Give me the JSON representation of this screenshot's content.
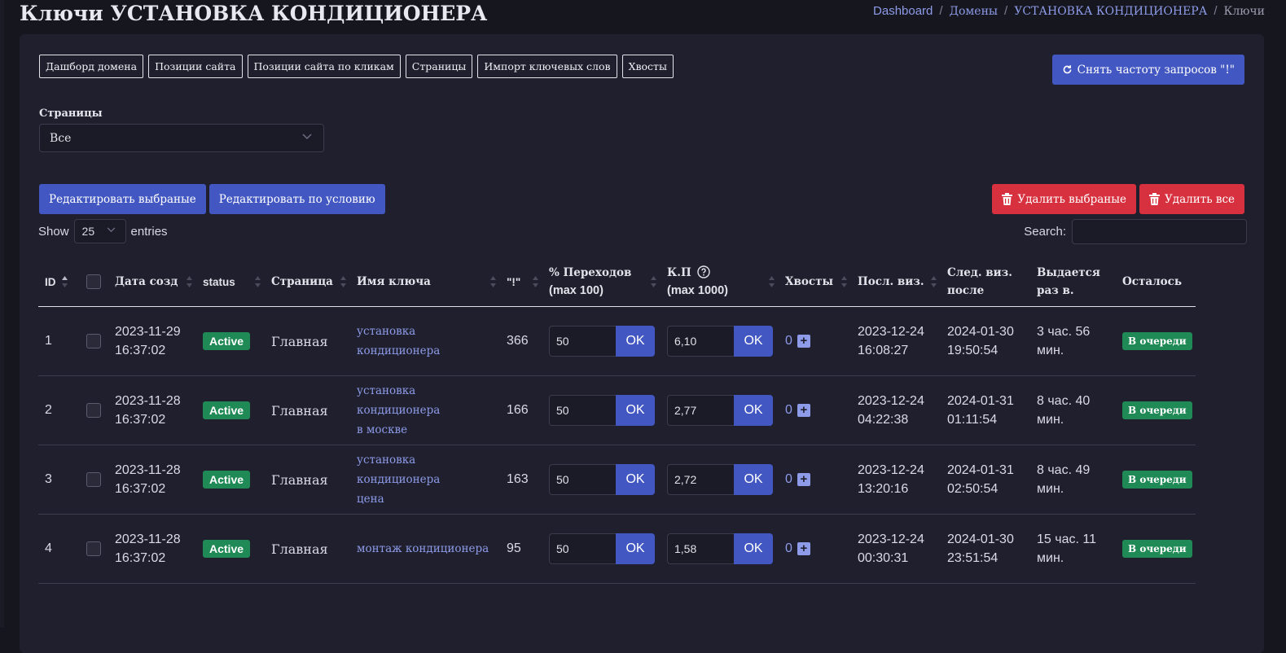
{
  "page": {
    "title": "Ключи УСТАНОВКА КОНДИЦИОНЕРА"
  },
  "breadcrumb": {
    "items": [
      "Dashboard",
      "Домены",
      "УСТАНОВКА КОНДИЦИОНЕРА"
    ],
    "current": "Ключи",
    "separator": "/"
  },
  "tabs": [
    "Дашборд домена",
    "Позиции сайта",
    "Позиции сайта по кликам",
    "Страницы",
    "Импорт ключевых слов",
    "Хвосты"
  ],
  "refresh_button": {
    "label": "Снять частоту запросов \"!\"",
    "icon": "refresh-icon"
  },
  "pages_filter": {
    "label": "Страницы",
    "value": "Все"
  },
  "actions": {
    "edit_selected": "Редактировать выбраные",
    "edit_by_condition": "Редактировать по условию",
    "delete_selected": "Удалить выбраные",
    "delete_all": "Удалить все"
  },
  "datatable": {
    "show_label": "Show",
    "length": "25",
    "entries_label": "entries",
    "search_label": "Search:",
    "search_value": ""
  },
  "columns": {
    "id": "ID",
    "date": "Дата созд",
    "status": "status",
    "page": "Страница",
    "key": "Имя ключа",
    "excl": "\"!\"",
    "transitions_1": "% Переходов",
    "transitions_2": "(max 100)",
    "kp_1": "К.П",
    "kp_2": "(max 1000)",
    "tails": "Хвосты",
    "last_visit": "Посл. виз.",
    "next_1": "След. виз.",
    "next_2": "после",
    "issued_1": "Выдается",
    "issued_2": "раз в.",
    "remaining": "Осталось"
  },
  "rows": [
    {
      "id": "1",
      "date": "2023-11-29",
      "time": "16:37:02",
      "status": "Active",
      "page": "Главная",
      "key_1": "установка кондиционера",
      "key_2": "",
      "excl": "366",
      "transitions": "50",
      "kp": "6,10",
      "ok": "OK",
      "tails": "0",
      "last_date": "2023-12-24",
      "last_time": "16:08:27",
      "next_date": "2024-01-30",
      "next_time": "19:50:54",
      "issued_1": "3 час. 56",
      "issued_2": "мин.",
      "remaining": "В очереди"
    },
    {
      "id": "2",
      "date": "2023-11-28",
      "time": "16:37:02",
      "status": "Active",
      "page": "Главная",
      "key_1": "установка кондиционера",
      "key_2": "в москве",
      "excl": "166",
      "transitions": "50",
      "kp": "2,77",
      "ok": "OK",
      "tails": "0",
      "last_date": "2023-12-24",
      "last_time": "04:22:38",
      "next_date": "2024-01-31",
      "next_time": "01:11:54",
      "issued_1": "8 час. 40",
      "issued_2": "мин.",
      "remaining": "В очереди"
    },
    {
      "id": "3",
      "date": "2023-11-28",
      "time": "16:37:02",
      "status": "Active",
      "page": "Главная",
      "key_1": "установка кондиционера",
      "key_2": "цена",
      "excl": "163",
      "transitions": "50",
      "kp": "2,72",
      "ok": "OK",
      "tails": "0",
      "last_date": "2023-12-24",
      "last_time": "13:20:16",
      "next_date": "2024-01-31",
      "next_time": "02:50:54",
      "issued_1": "8 час. 49",
      "issued_2": "мин.",
      "remaining": "В очереди"
    },
    {
      "id": "4",
      "date": "2023-11-28",
      "time": "16:37:02",
      "status": "Active",
      "page": "Главная",
      "key_1": "монтаж кондиционера",
      "key_2": "",
      "excl": "95",
      "transitions": "50",
      "kp": "1,58",
      "ok": "OK",
      "tails": "0",
      "last_date": "2023-12-24",
      "last_time": "00:30:31",
      "next_date": "2024-01-30",
      "next_time": "23:51:54",
      "issued_1": "15 час. 11",
      "issued_2": "мин.",
      "remaining": "В очереди"
    }
  ],
  "colors": {
    "background": "#16161f",
    "card": "#1f1f2d",
    "primary": "#4257c2",
    "danger": "#d7303f",
    "success": "#1f8a55",
    "link": "#8d9be8"
  }
}
